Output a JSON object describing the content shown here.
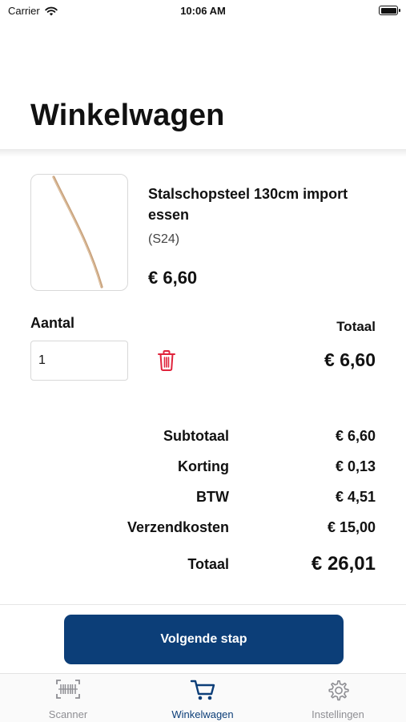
{
  "status_bar": {
    "carrier": "Carrier",
    "time": "10:06 AM"
  },
  "header": {
    "title": "Winkelwagen"
  },
  "cart": {
    "item": {
      "name": "Stalschopsteel 130cm import essen",
      "code": "(S24)",
      "price": "€ 6,60",
      "quantity_label": "Aantal",
      "quantity": "1",
      "line_total_label": "Totaal",
      "line_total": "€ 6,60"
    },
    "summary": {
      "subtotal_label": "Subtotaal",
      "subtotal": "€ 6,60",
      "discount_label": "Korting",
      "discount": "€ 0,13",
      "vat_label": "BTW",
      "vat": "€ 4,51",
      "shipping_label": "Verzendkosten",
      "shipping": "€ 15,00",
      "total_label": "Totaal",
      "total": "€ 26,01"
    }
  },
  "actions": {
    "next_label": "Volgende stap"
  },
  "tabs": [
    {
      "label": "Scanner",
      "icon": "barcode-scan-icon",
      "active": false
    },
    {
      "label": "Winkelwagen",
      "icon": "cart-icon",
      "active": true
    },
    {
      "label": "Instellingen",
      "icon": "gear-icon",
      "active": false
    }
  ],
  "colors": {
    "primary": "#0c3e78",
    "delete": "#e0243c",
    "inactive_tab": "#8e8e93"
  }
}
